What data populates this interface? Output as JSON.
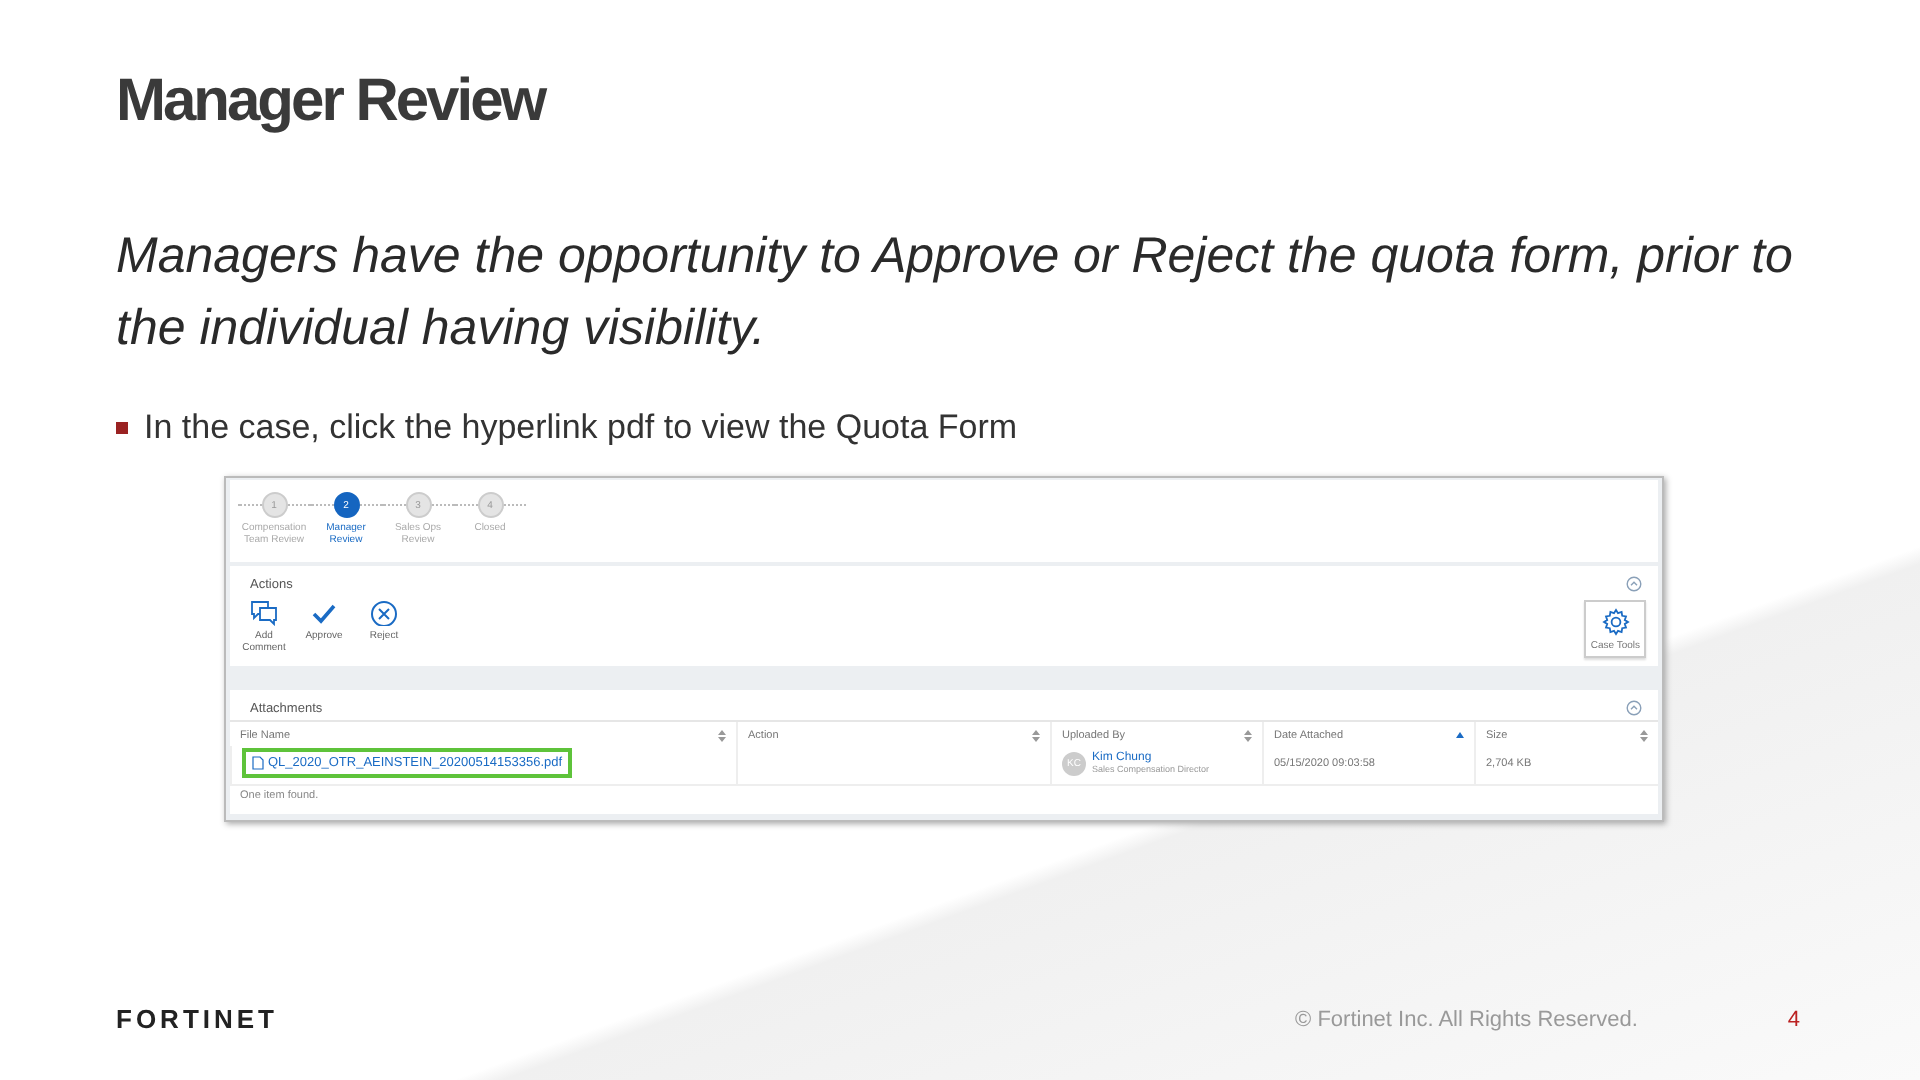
{
  "title": "Manager Review",
  "subtitle": "Managers have the opportunity to Approve or Reject the quota form, prior to the individual having visibility.",
  "bullets": [
    "In the case, click the hyperlink pdf to view the Quota Form"
  ],
  "screenshot": {
    "steps": [
      {
        "number": "1",
        "label": "Compensation Team Review",
        "selected": false
      },
      {
        "number": "2",
        "label": "Manager Review",
        "selected": true
      },
      {
        "number": "3",
        "label": "Sales Ops Review",
        "selected": false
      },
      {
        "number": "4",
        "label": "Closed",
        "selected": false
      }
    ],
    "actions": {
      "title": "Actions",
      "buttons": [
        {
          "kind": "comment",
          "label": "Add Comment"
        },
        {
          "kind": "approve",
          "label": "Approve"
        },
        {
          "kind": "reject",
          "label": "Reject"
        }
      ],
      "tool": "Case Tools"
    },
    "attachments": {
      "title": "Attachments",
      "columns": [
        {
          "label": "File Name",
          "sorted": false
        },
        {
          "label": "Action",
          "sorted": false
        },
        {
          "label": "Uploaded By",
          "sorted": false
        },
        {
          "label": "Date Attached",
          "sorted": true
        },
        {
          "label": "Size",
          "sorted": false
        }
      ],
      "rows": [
        {
          "file": "QL_2020_OTR_AEINSTEIN_20200514153356.pdf",
          "highlighted": true,
          "initials": "KC",
          "uploader": "Kim Chung",
          "role": "Sales Compensation Director",
          "date": "05/15/2020 09:03:58",
          "size": "2,704 KB"
        }
      ],
      "footer": "One item found."
    }
  },
  "footer": {
    "logo": "FORTINET",
    "copyright": "© Fortinet Inc. All Rights Reserved.",
    "page": "4"
  }
}
